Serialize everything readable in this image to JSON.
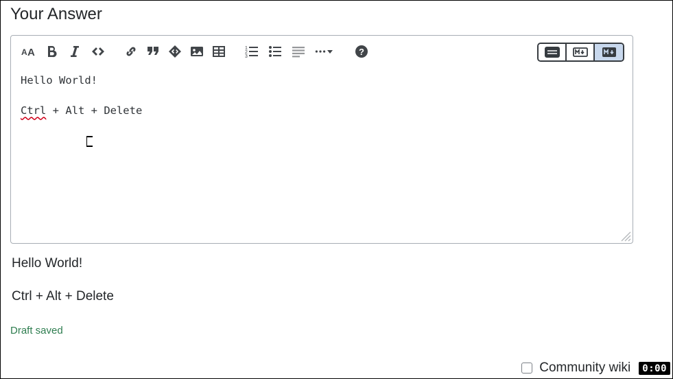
{
  "heading": "Your Answer",
  "editor": {
    "line1": "Hello World!",
    "line2_ctrl": "Ctrl",
    "line2_rest": " + Alt + Delete"
  },
  "preview": {
    "p1": "Hello World!",
    "p2": "Ctrl + Alt + Delete"
  },
  "draft_status": "Draft saved",
  "community_wiki_label": "Community wiki",
  "time_badge": "0:00",
  "toolbar": {
    "heading_tip": "Heading",
    "bold_tip": "Bold",
    "italic_tip": "Italic",
    "code_tip": "Code",
    "link_tip": "Link",
    "quote_tip": "Blockquote",
    "snippet_tip": "Code snippet",
    "image_tip": "Image",
    "table_tip": "Table",
    "ol_tip": "Numbered list",
    "ul_tip": "Bulleted list",
    "align_tip": "Align",
    "more_tip": "More",
    "help_tip": "Help"
  },
  "view": {
    "rich_tip": "Rich text",
    "md_tip": "Markdown",
    "split_tip": "Preview"
  }
}
